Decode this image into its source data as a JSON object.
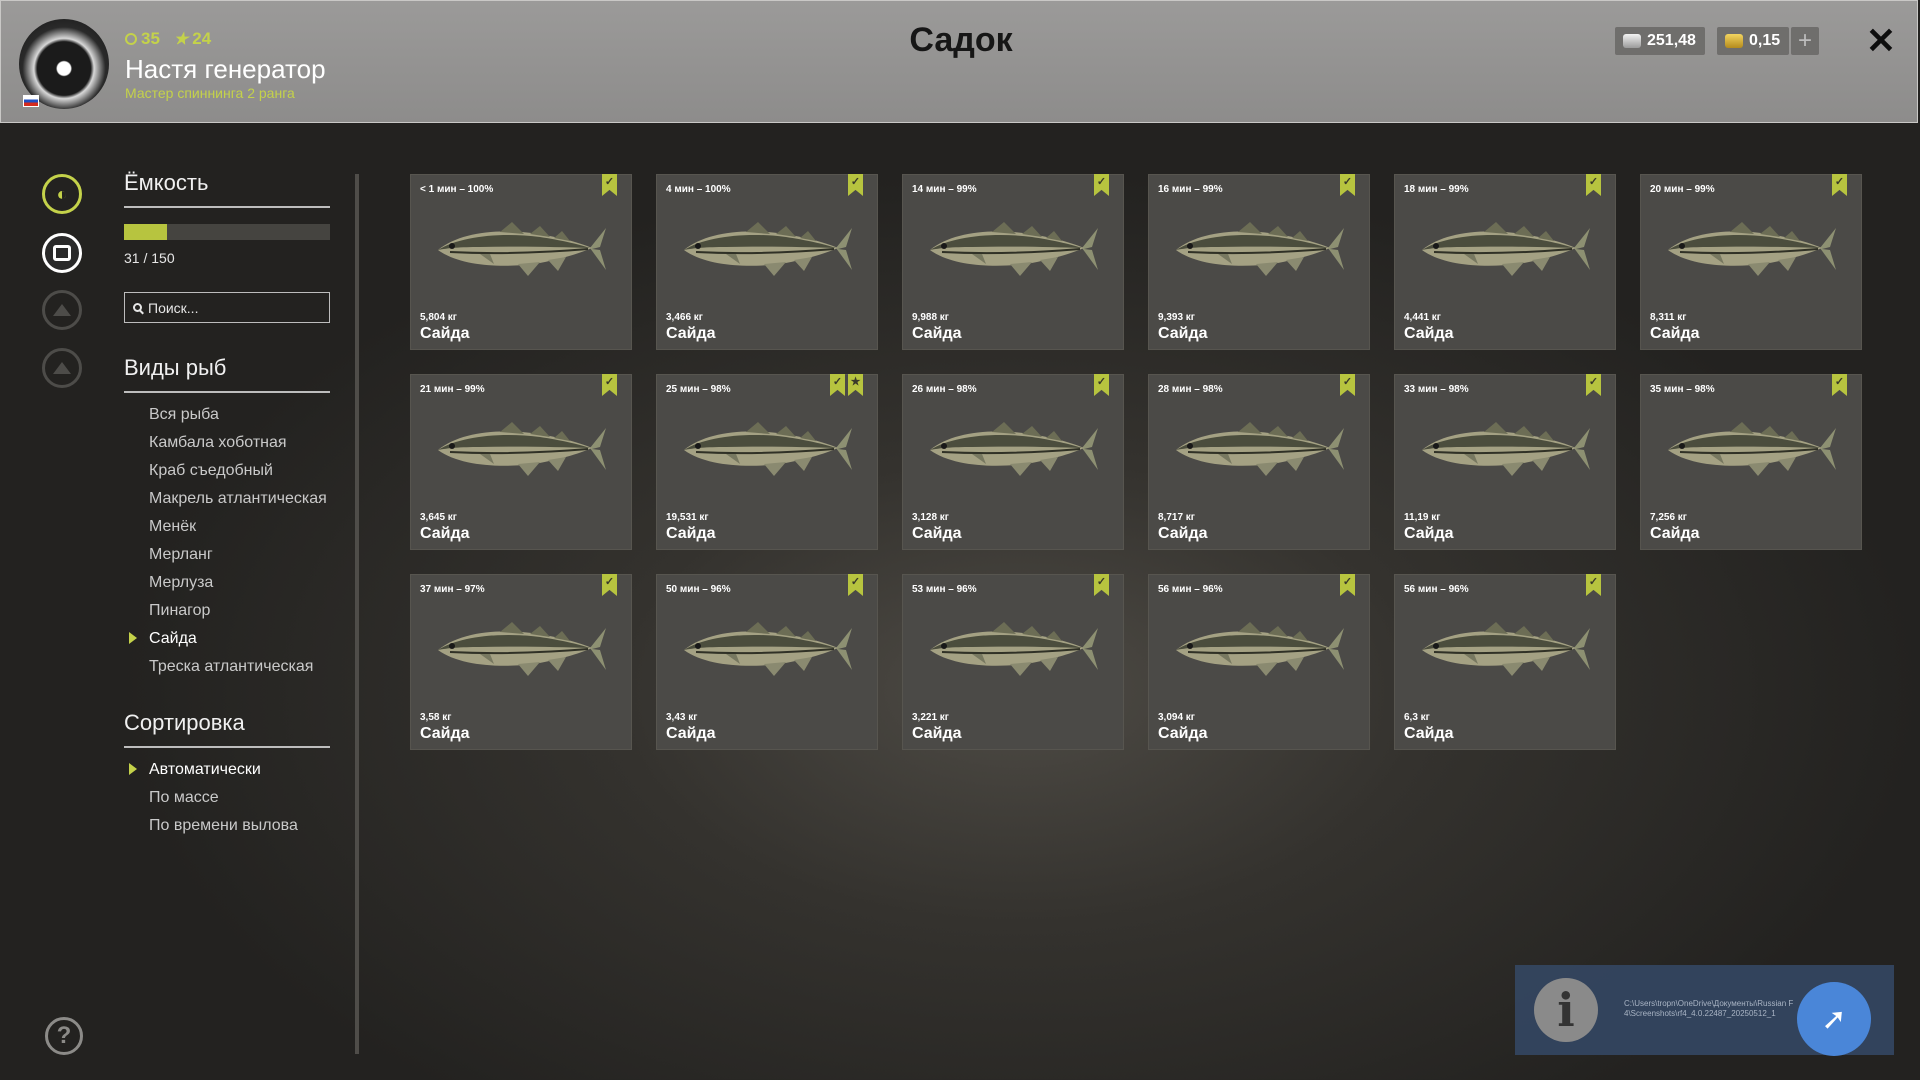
{
  "header": {
    "title": "Садок",
    "player_name": "Настя генератор",
    "rank_text": "Мастер спиннинга 2 ранга",
    "level": "35",
    "stars": "24",
    "silver": "251,48",
    "gold": "0,15",
    "add_label": "+",
    "close_label": "✕"
  },
  "colors": {
    "accent": "#c4d24a",
    "card_bg": "#4b4a47",
    "header_bg": "#9b9a99"
  },
  "rail": {
    "items": [
      {
        "icon": "fish-icon",
        "active": true
      },
      {
        "icon": "keepnet-icon",
        "active": true
      },
      {
        "icon": "camp-icon",
        "active": false
      },
      {
        "icon": "home-icon",
        "active": false
      }
    ],
    "help_label": "?"
  },
  "capacity": {
    "title": "Ёмкость",
    "used": 31,
    "total": 150,
    "text": "31 / 150"
  },
  "search": {
    "placeholder": "Поиск..."
  },
  "species": {
    "title": "Виды рыб",
    "items": [
      "Вся рыба",
      "Камбала хоботная",
      "Краб съедобный",
      "Макрель атлантическая",
      "Менёк",
      "Мерланг",
      "Мерлуза",
      "Пинагор",
      "Сайда",
      "Треска атлантическая"
    ],
    "selected": "Сайда"
  },
  "sort": {
    "title": "Сортировка",
    "items": [
      "Автоматически",
      "По массе",
      "По времени вылова"
    ],
    "selected": "Автоматически"
  },
  "fish_cards": [
    {
      "time": "< 1 мин – 100%",
      "weight": "5,804 кг",
      "name": "Сайда",
      "trophy": false
    },
    {
      "time": "4 мин – 100%",
      "weight": "3,466 кг",
      "name": "Сайда",
      "trophy": false
    },
    {
      "time": "14 мин – 99%",
      "weight": "9,988 кг",
      "name": "Сайда",
      "trophy": false
    },
    {
      "time": "16 мин – 99%",
      "weight": "9,393 кг",
      "name": "Сайда",
      "trophy": false
    },
    {
      "time": "18 мин – 99%",
      "weight": "4,441 кг",
      "name": "Сайда",
      "trophy": false
    },
    {
      "time": "20 мин – 99%",
      "weight": "8,311 кг",
      "name": "Сайда",
      "trophy": false
    },
    {
      "time": "21 мин – 99%",
      "weight": "3,645 кг",
      "name": "Сайда",
      "trophy": false
    },
    {
      "time": "25 мин – 98%",
      "weight": "19,531 кг",
      "name": "Сайда",
      "trophy": true
    },
    {
      "time": "26 мин – 98%",
      "weight": "3,128 кг",
      "name": "Сайда",
      "trophy": false
    },
    {
      "time": "28 мин – 98%",
      "weight": "8,717 кг",
      "name": "Сайда",
      "trophy": false
    },
    {
      "time": "33 мин – 98%",
      "weight": "11,19 кг",
      "name": "Сайда",
      "trophy": false
    },
    {
      "time": "35 мин – 98%",
      "weight": "7,256 кг",
      "name": "Сайда",
      "trophy": false
    },
    {
      "time": "37 мин – 97%",
      "weight": "3,58 кг",
      "name": "Сайда",
      "trophy": false
    },
    {
      "time": "50 мин – 96%",
      "weight": "3,43 кг",
      "name": "Сайда",
      "trophy": false
    },
    {
      "time": "53 мин – 96%",
      "weight": "3,221 кг",
      "name": "Сайда",
      "trophy": false
    },
    {
      "time": "56 мин – 96%",
      "weight": "3,094 кг",
      "name": "Сайда",
      "trophy": false
    },
    {
      "time": "56 мин – 96%",
      "weight": "6,3 кг",
      "name": "Сайда",
      "trophy": false
    }
  ],
  "notification": {
    "icon": "info-icon",
    "path_line1": "C:\\Users\\tropn\\OneDrive\\Документы\\Russian F",
    "path_line2": "4\\Screenshots\\rf4_4.0.22487_20250512_1"
  }
}
